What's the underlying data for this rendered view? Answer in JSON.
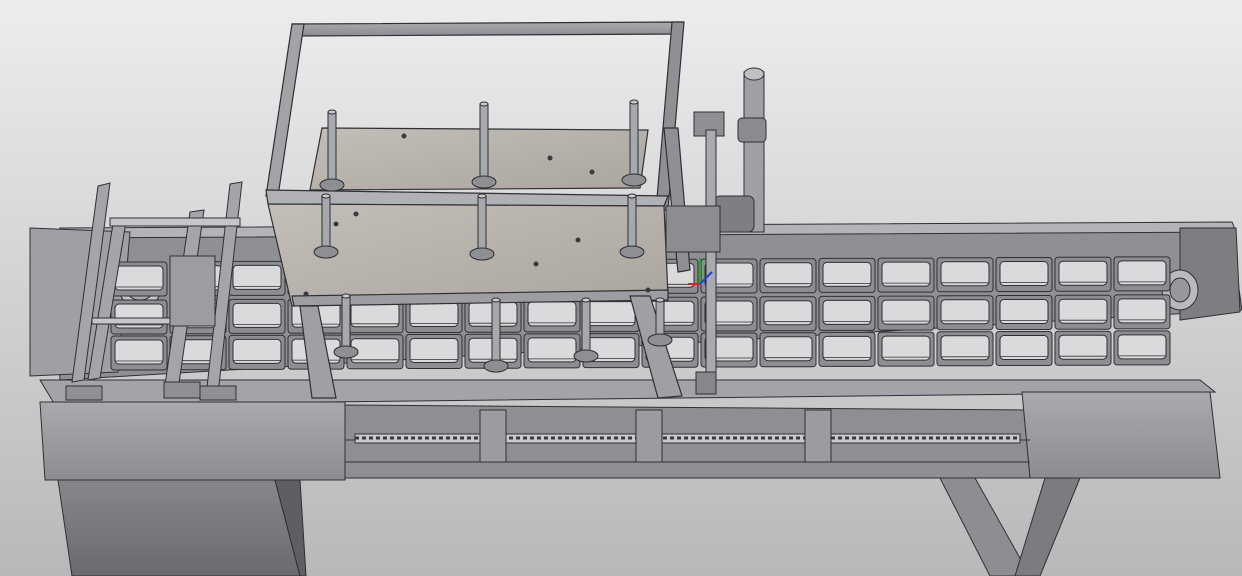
{
  "scene": {
    "description_visible_text": "",
    "tray_rows": 3,
    "tray_columns_visible": 18
  },
  "colors": {
    "background_top": "#ececec",
    "background_bottom": "#b9b9b9",
    "frame_steel": "#9a9a9e",
    "frame_dark": "#6f7074",
    "plate": "#b7b2ab",
    "edge": "#2f3035",
    "tray_cell": "#d9dadc",
    "axis_red": "#e02020",
    "axis_green": "#20b020",
    "axis_blue": "#2040e0"
  }
}
